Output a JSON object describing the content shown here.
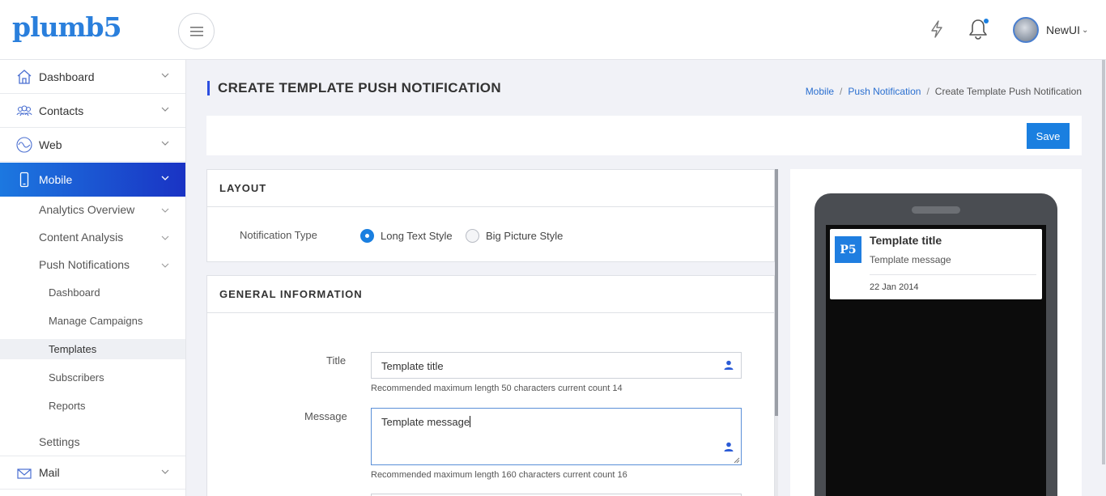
{
  "app": {
    "logo_text": "plumb5",
    "accent_color": "#1a7fe0"
  },
  "header": {
    "menu_icon": "hamburger-icon",
    "quick_icon": "bolt-icon",
    "notification_icon": "bell-icon",
    "user": {
      "name": "NewUI",
      "avatar_icon": "globe-avatar"
    }
  },
  "sidebar": {
    "items": [
      {
        "label": "Dashboard",
        "icon": "home-icon"
      },
      {
        "label": "Contacts",
        "icon": "contacts-icon"
      },
      {
        "label": "Web",
        "icon": "wave-icon"
      },
      {
        "label": "Mobile",
        "icon": "mobile-icon",
        "active": true
      },
      {
        "label": "Mail",
        "icon": "mail-icon"
      }
    ],
    "mobile_sub": {
      "analytics": "Analytics Overview",
      "content": "Content Analysis",
      "push": "Push Notifications",
      "push_children": [
        "Dashboard",
        "Manage Campaigns",
        "Templates",
        "Subscribers",
        "Reports"
      ],
      "settings": "Settings"
    }
  },
  "page": {
    "title": "CREATE TEMPLATE PUSH NOTIFICATION",
    "breadcrumb": [
      "Mobile",
      "Push Notification",
      "Create Template Push Notification"
    ],
    "save_label": "Save"
  },
  "layout_panel": {
    "heading": "LAYOUT",
    "field_label": "Notification Type",
    "options": [
      "Long Text Style",
      "Big Picture Style"
    ],
    "selected": "Long Text Style"
  },
  "general_panel": {
    "heading": "GENERAL INFORMATION",
    "title_label": "Title",
    "title_value": "Template title",
    "title_hint": "Recommended maximum length 50 characters current count 14",
    "message_label": "Message",
    "message_value": "Template message",
    "message_hint": "Recommended maximum length 160 characters current count 16"
  },
  "preview": {
    "badge": "P5",
    "title": "Template title",
    "message": "Template message",
    "date": "22 Jan 2014"
  }
}
